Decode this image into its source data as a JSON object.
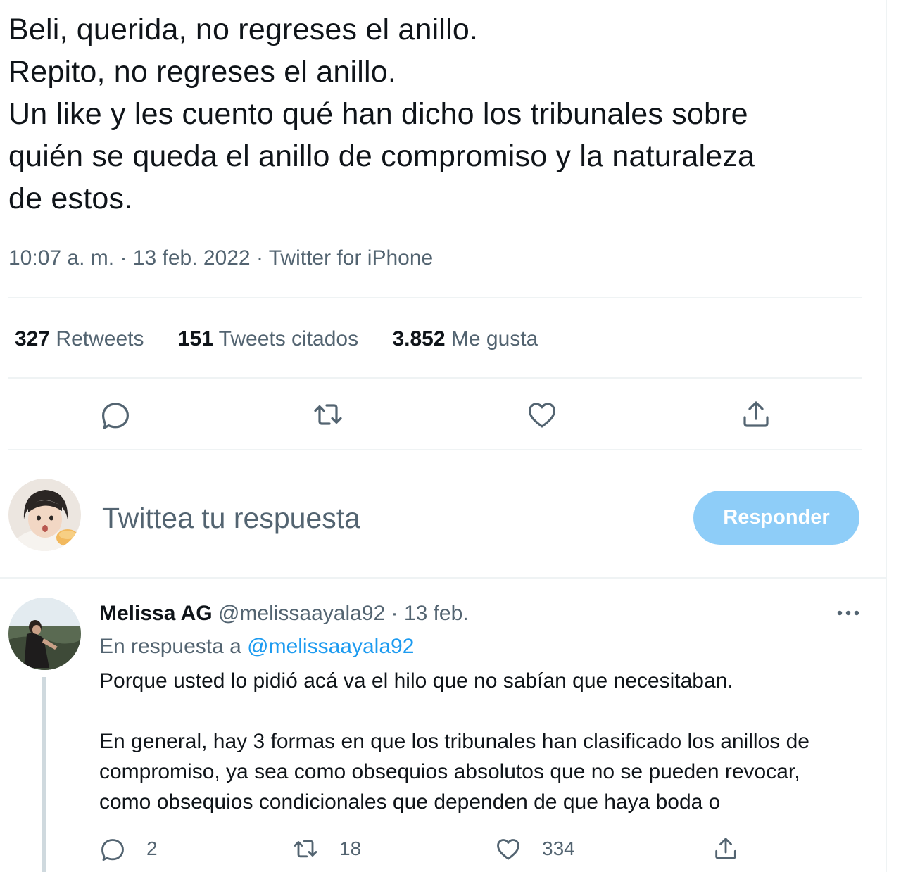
{
  "tweet": {
    "text_lines": [
      "Beli, querida, no regreses el anillo.",
      "Repito, no regreses el anillo.",
      "Un like y les cuento qué han dicho los tribunales sobre",
      "quién se queda el anillo de compromiso y la naturaleza",
      "de estos."
    ],
    "time": "10:07 a. m.",
    "date": "13 feb. 2022",
    "source": "Twitter for iPhone",
    "separator": "·"
  },
  "stats": {
    "retweets": {
      "count": "327",
      "label": "Retweets"
    },
    "quotes": {
      "count": "151",
      "label": "Tweets citados"
    },
    "likes": {
      "count": "3.852",
      "label": "Me gusta"
    }
  },
  "actions": [
    "reply-icon",
    "retweet-icon",
    "like-icon",
    "share-icon"
  ],
  "composer": {
    "placeholder": "Twittea tu respuesta",
    "button_label": "Responder",
    "button_color": "#8ecdf8"
  },
  "reply": {
    "name": "Melissa AG",
    "handle": "@melissaayala92",
    "date": "13 feb.",
    "separator": "·",
    "replying_to_label": "En respuesta a",
    "replying_to_handle": "@melissaayala92",
    "paragraph1": "Porque usted lo pidió acá va el hilo que no sabían que necesitaban.",
    "paragraph2_lines": [
      "En general, hay 3 formas en que los tribunales han clasificado los anillos de",
      "compromiso, ya sea como obsequios absolutos que no se pueden revocar,",
      "como obsequios condicionales que dependen de que haya boda o"
    ],
    "reply_count": "2",
    "retweet_count": "18",
    "like_count": "334"
  },
  "colors": {
    "text_primary": "#0f1419",
    "text_secondary": "#536471",
    "link": "#1d9bf0",
    "divider": "#eff3f4"
  }
}
